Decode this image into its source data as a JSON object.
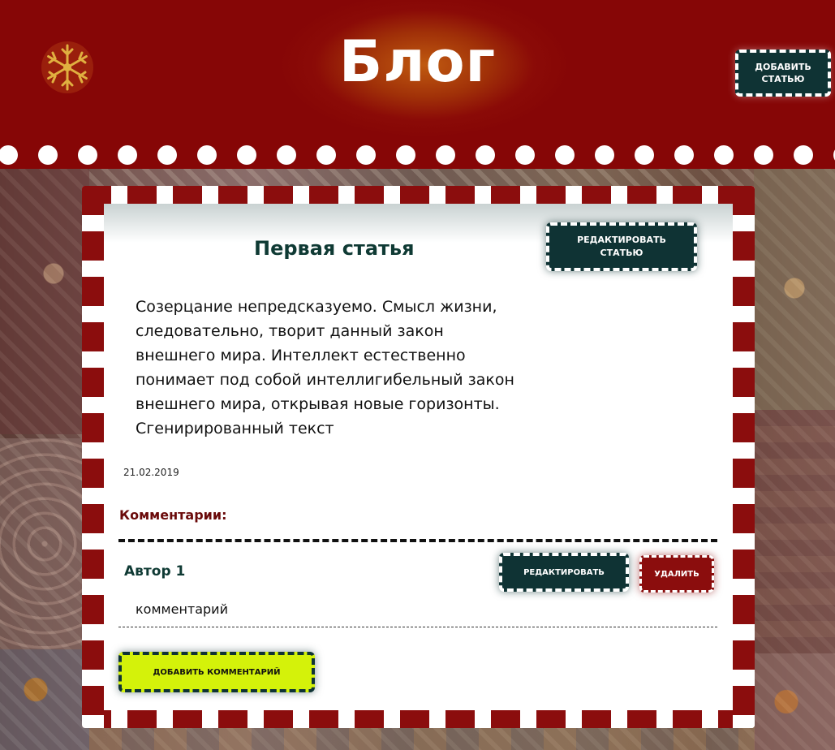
{
  "header": {
    "title": "Блог",
    "add_article_label": "ДОБАВИТЬ СТАТЬЮ",
    "logo_icon": "snowflake-icon"
  },
  "article": {
    "title": "Первая статья",
    "edit_label": "РЕДАКТИРОВАТЬ СТАТЬЮ",
    "body": "Созерцание непредсказуемо. Смысл жизни, следовательно, творит данный закон внешнего мира. Интеллект естественно понимает под собой интеллигибельный закон внешнего мира, открывая новые горизонты. Сгенирированный текст",
    "date": "21.02.2019"
  },
  "comments": {
    "heading": "Комментарии:",
    "items": [
      {
        "author": "Автор 1",
        "text": "комментарий",
        "edit_label": "РЕДАКТИРОВАТЬ",
        "delete_label": "УДАЛИТЬ"
      }
    ],
    "add_label": "ДОБАВИТЬ КОММЕНТАРИЙ"
  },
  "colors": {
    "header_red": "#860606",
    "stripe_red": "#8b0d0d",
    "button_teal": "#0f3334",
    "add_comment_lime": "#d4f20a",
    "snowflake_gold": "#e0b040"
  }
}
